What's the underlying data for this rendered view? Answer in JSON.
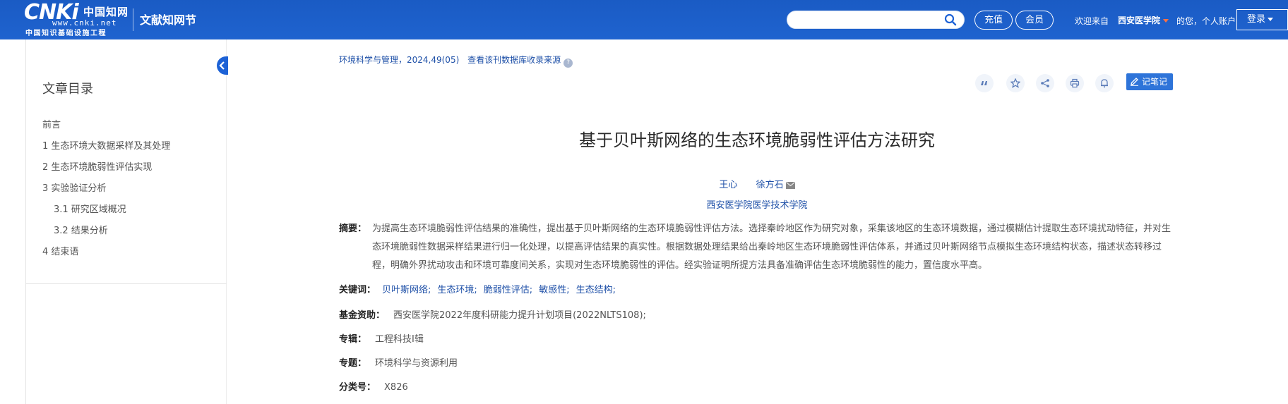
{
  "header": {
    "logo": {
      "brand": "CNKi",
      "cn_name": "中国知网",
      "url": "www.cnki.net",
      "slogan": "中国知识基础设施工程"
    },
    "site_name": "文献知网节",
    "search": {
      "value": "",
      "placeholder": ""
    },
    "recharge_label": "充值",
    "member_label": "会员",
    "welcome": "欢迎来自",
    "organization": "西安医学院",
    "greeting": "的您，个人账户",
    "login_label": "登录",
    "colors": {
      "bar": "#1f63cf",
      "caret_accent": "#ff7043"
    }
  },
  "sidebar": {
    "title": "文章目录",
    "items": [
      {
        "label": "前言",
        "level": 1
      },
      {
        "label": "1 生态环境大数据采样及其处理",
        "level": 1
      },
      {
        "label": "2 生态环境脆弱性评估实现",
        "level": 1
      },
      {
        "label": "3 实验验证分析",
        "level": 1
      },
      {
        "label": "3.1 研究区域概况",
        "level": 2
      },
      {
        "label": "3.2 结果分析",
        "level": 2
      },
      {
        "label": "4 结束语",
        "level": 1
      }
    ]
  },
  "article": {
    "source": "环境科学与管理，2024,49(05)",
    "source_link": "查看该刊数据库收录来源",
    "tools": [
      "quote-icon",
      "star-icon",
      "share-icon",
      "print-icon",
      "bell-icon"
    ],
    "note_label": "记笔记",
    "title": "基于贝叶斯网络的生态环境脆弱性评估方法研究",
    "authors": [
      "王心",
      "徐方石"
    ],
    "affiliation": "西安医学院医学技术学院",
    "abstract_label": "摘要：",
    "abstract": "为提高生态环境脆弱性评估结果的准确性，提出基于贝叶斯网络的生态环境脆弱性评估方法。选择秦岭地区作为研究对象，采集该地区的生态环境数据，通过模糊估计提取生态环境扰动特征，并对生态环境脆弱性数据采样结果进行归一化处理，以提高评估结果的真实性。根据数据处理结果给出秦岭地区生态环境脆弱性评估体系，并通过贝叶斯网络节点模拟生态环境结构状态，描述状态转移过程，明确外界扰动攻击和环境可靠度间关系，实现对生态环境脆弱性的评估。经实验证明所提方法具备准确评估生态环境脆弱性的能力，置信度水平高。",
    "keywords_label": "关键词：",
    "keywords": [
      "贝叶斯网络;",
      "生态环境;",
      "脆弱性评估;",
      "敏感性;",
      "生态结构;"
    ],
    "fund_label": "基金资助：",
    "fund": "西安医学院2022年度科研能力提升计划项目(2022NLTS108);",
    "zhuanji_label": "专辑：",
    "zhuanji": "工程科技Ⅰ辑",
    "zhuanti_label": "专题：",
    "zhuanti": "环境科学与资源利用",
    "cls_label": "分类号：",
    "cls": "X826"
  }
}
